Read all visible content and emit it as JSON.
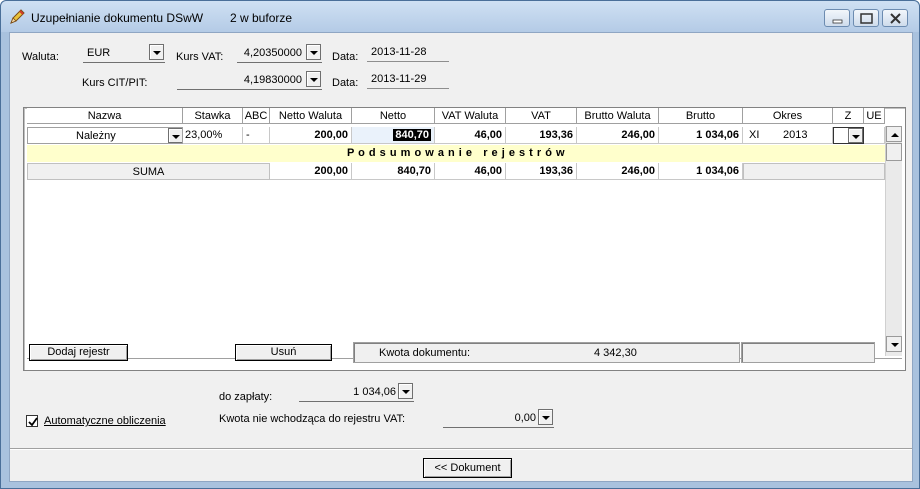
{
  "window": {
    "title": "Uzupełnianie dokumentu DSwW",
    "buffer_info": "2 w buforze",
    "accent": "#b4cbe6"
  },
  "header": {
    "waluta_label": "Waluta:",
    "waluta_value": "EUR",
    "kurs_vat_label": "Kurs VAT:",
    "kurs_vat_value": "4,20350000",
    "data1_label": "Data:",
    "data1_value": "2013-11-28",
    "kurs_cit_label": "Kurs CIT/PIT:",
    "kurs_cit_value": "4,19830000",
    "data2_label": "Data:",
    "data2_value": "2013-11-29"
  },
  "grid": {
    "columns": [
      "Nazwa",
      "Stawka",
      "ABC",
      "Netto Waluta",
      "Netto",
      "VAT Waluta",
      "VAT",
      "Brutto Waluta",
      "Brutto",
      "Okres",
      "Z",
      "UE"
    ],
    "row": {
      "nazwa": "Należny",
      "stawka": "23,00%",
      "abc": "-",
      "netto_waluta": "200,00",
      "netto": "840,70",
      "vat_waluta": "46,00",
      "vat": "193,36",
      "brutto_waluta": "246,00",
      "brutto": "1 034,06",
      "okres_month": "XI",
      "okres_year": "2013"
    },
    "summary_title": "P o d s u m o w a n i e   r e j e s t r ó w",
    "sum_row": {
      "label": "SUMA",
      "netto_waluta": "200,00",
      "netto": "840,70",
      "vat_waluta": "46,00",
      "vat": "193,36",
      "brutto_waluta": "246,00",
      "brutto": "1 034,06"
    },
    "summary_color": "#ffffcc"
  },
  "footer": {
    "add_button": "Dodaj rejestr",
    "delete_button": "Usuń",
    "kwota_label": "Kwota dokumentu:",
    "kwota_value": "4 342,30"
  },
  "bottom": {
    "do_zaplaty_label": "do zapłaty:",
    "do_zaplaty_value": "1 034,06",
    "auto_label": "Automatyczne obliczenia",
    "auto_checked": true,
    "kwota_nie_label": "Kwota nie wchodząca do rejestru VAT:",
    "kwota_nie_value": "0,00",
    "dokument_button": "<< Dokument"
  }
}
